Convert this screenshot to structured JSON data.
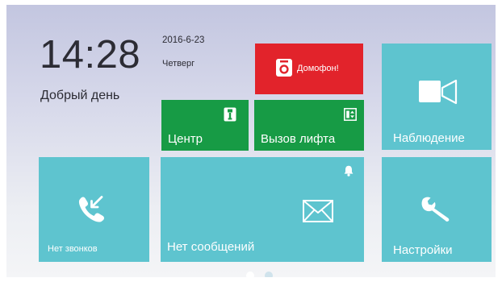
{
  "clock": {
    "time": "14:28",
    "greeting": "Добрый день"
  },
  "date": {
    "date": "2016-6-23",
    "weekday": "Четверг"
  },
  "tiles": {
    "intercom": {
      "label": "Домофон!",
      "icon": "intercom-icon",
      "color": "#e2232b"
    },
    "center": {
      "label": "Центр",
      "icon": "concierge-icon",
      "color": "#179b45"
    },
    "elevator": {
      "label": "Вызов лифта",
      "icon": "elevator-icon",
      "color": "#179b45"
    },
    "surveillance": {
      "label": "Наблюдение",
      "icon": "video-camera-icon",
      "color": "#5ec4cf"
    },
    "calls": {
      "label": "Нет звонков",
      "icon": "missed-call-icon",
      "color": "#5ec4cf"
    },
    "messages": {
      "label": "Нет сообщений",
      "icon": "envelope-icon",
      "color": "#5ec4cf",
      "badge_icon": "bell-icon"
    },
    "settings": {
      "label": "Настройки",
      "icon": "wrench-icon",
      "color": "#5ec4cf"
    }
  },
  "pagination": {
    "pages": 2,
    "current": 1
  }
}
